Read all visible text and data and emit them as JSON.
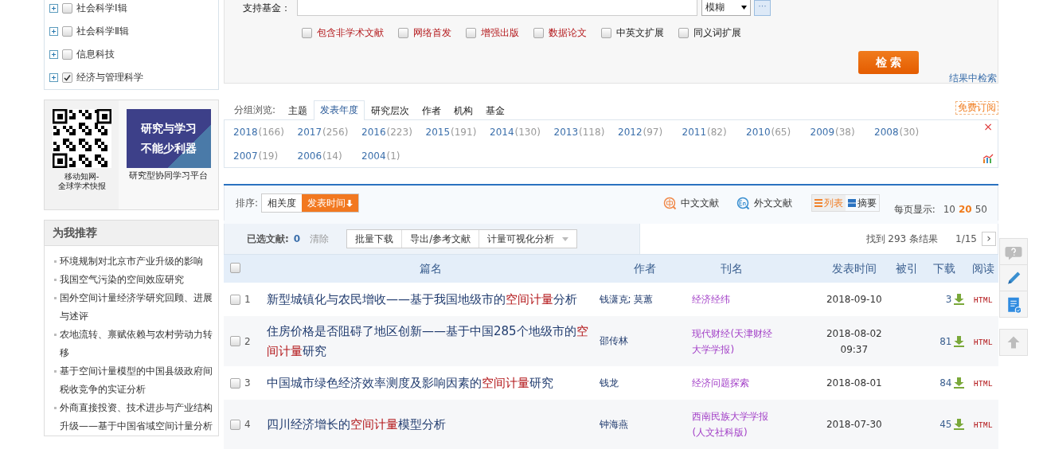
{
  "categories": [
    {
      "label": "社会科学Ⅰ辑",
      "checked": false
    },
    {
      "label": "社会科学Ⅱ辑",
      "checked": false
    },
    {
      "label": "信息科技",
      "checked": false
    },
    {
      "label": "经济与管理科学",
      "checked": true
    }
  ],
  "promo": {
    "qr_caption": "移动知网-\n全球学术快报",
    "banner_lines": [
      "研究与学习",
      "不能少利器"
    ],
    "banner_caption": "研究型协同学习平台"
  },
  "recommend": {
    "title": "为我推荐",
    "items": [
      "环境规制对北京市产业升级的影响",
      "我国空气污染的空间效应研究",
      "国外空间计量经济学研究回顾、进展与述评",
      "农地流转、禀赋依赖与农村劳动力转移",
      "基于空间计量模型的中国县级政府间税收竞争的实证分析",
      "外商直接投资、技术进步与产业结构升级——基于中国省域空间计量分析"
    ]
  },
  "search": {
    "fund_label": "支持基金：",
    "match_select": "模糊",
    "more_button": "···",
    "options": [
      {
        "label": "包含非学术文献",
        "checked": false,
        "kind": "special"
      },
      {
        "label": "网络首发",
        "checked": false,
        "kind": "special"
      },
      {
        "label": "增强出版",
        "checked": false,
        "kind": "special"
      },
      {
        "label": "数据论文",
        "checked": false,
        "kind": "special"
      },
      {
        "label": "中英文扩展",
        "checked": false,
        "kind": "plain"
      },
      {
        "label": "同义词扩展",
        "checked": false,
        "kind": "plain"
      }
    ],
    "search_button": "检 索",
    "within_results": "结果中检索"
  },
  "group_browse": {
    "label": "分组浏览:",
    "tabs": [
      {
        "label": "主题",
        "selected": false
      },
      {
        "label": "发表年度",
        "selected": true
      },
      {
        "label": "研究层次",
        "selected": false
      },
      {
        "label": "作者",
        "selected": false
      },
      {
        "label": "机构",
        "selected": false
      },
      {
        "label": "基金",
        "selected": false
      }
    ],
    "subscribe": "免费订阅",
    "years": [
      {
        "year": "2018",
        "count": "(166)"
      },
      {
        "year": "2017",
        "count": "(256)"
      },
      {
        "year": "2016",
        "count": "(223)"
      },
      {
        "year": "2015",
        "count": "(191)"
      },
      {
        "year": "2014",
        "count": "(130)"
      },
      {
        "year": "2013",
        "count": "(118)"
      },
      {
        "year": "2012",
        "count": "(97)"
      },
      {
        "year": "2011",
        "count": "(82)"
      },
      {
        "year": "2010",
        "count": "(65)"
      },
      {
        "year": "2009",
        "count": "(38)"
      },
      {
        "year": "2008",
        "count": "(30)"
      },
      {
        "year": "2007",
        "count": "(19)"
      },
      {
        "year": "2006",
        "count": "(14)"
      },
      {
        "year": "2004",
        "count": "(1)"
      }
    ],
    "close": "×"
  },
  "results": {
    "sort_label": "排序:",
    "sort_options": [
      {
        "label": "相关度",
        "selected": false
      },
      {
        "label": "发表时间",
        "selected": true
      }
    ],
    "lang_filters": [
      "中文文献",
      "外文文献"
    ],
    "views": [
      {
        "label": "列表",
        "selected": true
      },
      {
        "label": "摘要",
        "selected": false
      }
    ],
    "per_page_label": "每页显示:",
    "per_page": [
      {
        "label": "10",
        "selected": false
      },
      {
        "label": "20",
        "selected": true
      },
      {
        "label": "50",
        "selected": false
      }
    ],
    "selected_label": "已选文献:",
    "selected_count": "0",
    "clear": "清除",
    "actions": [
      "批量下载",
      "导出/参考文献",
      "计量可视化分析"
    ],
    "found": "找到 293 条结果",
    "page": "1/15",
    "next": "›",
    "header_checked": false,
    "columns": [
      "篇名",
      "作者",
      "刊名",
      "发表时间",
      "被引",
      "下载",
      "阅读"
    ],
    "rows": [
      {
        "num": "1",
        "title": [
          {
            "text": "新型城镇化与农民增收——基于我国地级市的",
            "hl": false
          },
          {
            "text": "空间计量",
            "hl": true
          },
          {
            "text": "分析",
            "hl": false
          }
        ],
        "author": "钱潇克; 莫蕙",
        "journal": "经济经纬",
        "date": "2018-09-10",
        "downloads": "3",
        "read": "HTML",
        "checked": false
      },
      {
        "num": "2",
        "title": [
          {
            "text": "住房价格是否阻碍了地区创新——基于中国285个地级市的",
            "hl": false
          },
          {
            "text": "空间计量",
            "hl": true
          },
          {
            "text": "研究",
            "hl": false
          }
        ],
        "author": "邵传林",
        "journal": "现代财经(天津财经大学学报)",
        "date": "2018-08-02 09:37",
        "downloads": "81",
        "read": "HTML",
        "checked": false
      },
      {
        "num": "3",
        "title": [
          {
            "text": "中国城市绿色经济效率测度及影响因素的",
            "hl": false
          },
          {
            "text": "空间计量",
            "hl": true
          },
          {
            "text": "研究",
            "hl": false
          }
        ],
        "author": "钱龙",
        "journal": "经济问题探索",
        "date": "2018-08-01",
        "downloads": "84",
        "read": "HTML",
        "checked": false
      },
      {
        "num": "4",
        "title": [
          {
            "text": "四川经济增长的",
            "hl": false
          },
          {
            "text": "空间计量",
            "hl": true
          },
          {
            "text": "模型分析",
            "hl": false
          }
        ],
        "author": "钟海燕",
        "journal": "西南民族大学学报(人文社科版)",
        "date": "2018-07-30",
        "downloads": "45",
        "read": "HTML",
        "checked": false
      }
    ]
  }
}
